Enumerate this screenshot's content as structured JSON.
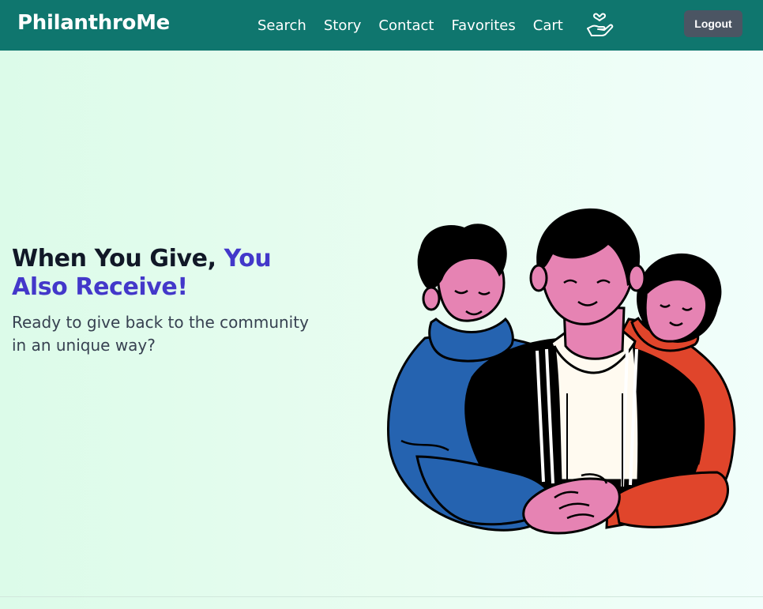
{
  "brand": {
    "name": "PhilanthroMe"
  },
  "nav": {
    "links": [
      "Search",
      "Story",
      "Contact",
      "Favorites",
      "Cart"
    ],
    "icon": "hand-heart-icon",
    "logout_label": "Logout"
  },
  "hero": {
    "title_main": "When You Give, ",
    "title_accent": "You Also Receive!",
    "subtitle": "Ready to give back to the community in an unique way?",
    "illustration": "three-people-embracing-illustration"
  },
  "colors": {
    "navbar": "#0f766e",
    "accent": "#4338ca",
    "logout": "#4b5563",
    "background": "#e3fcec"
  }
}
